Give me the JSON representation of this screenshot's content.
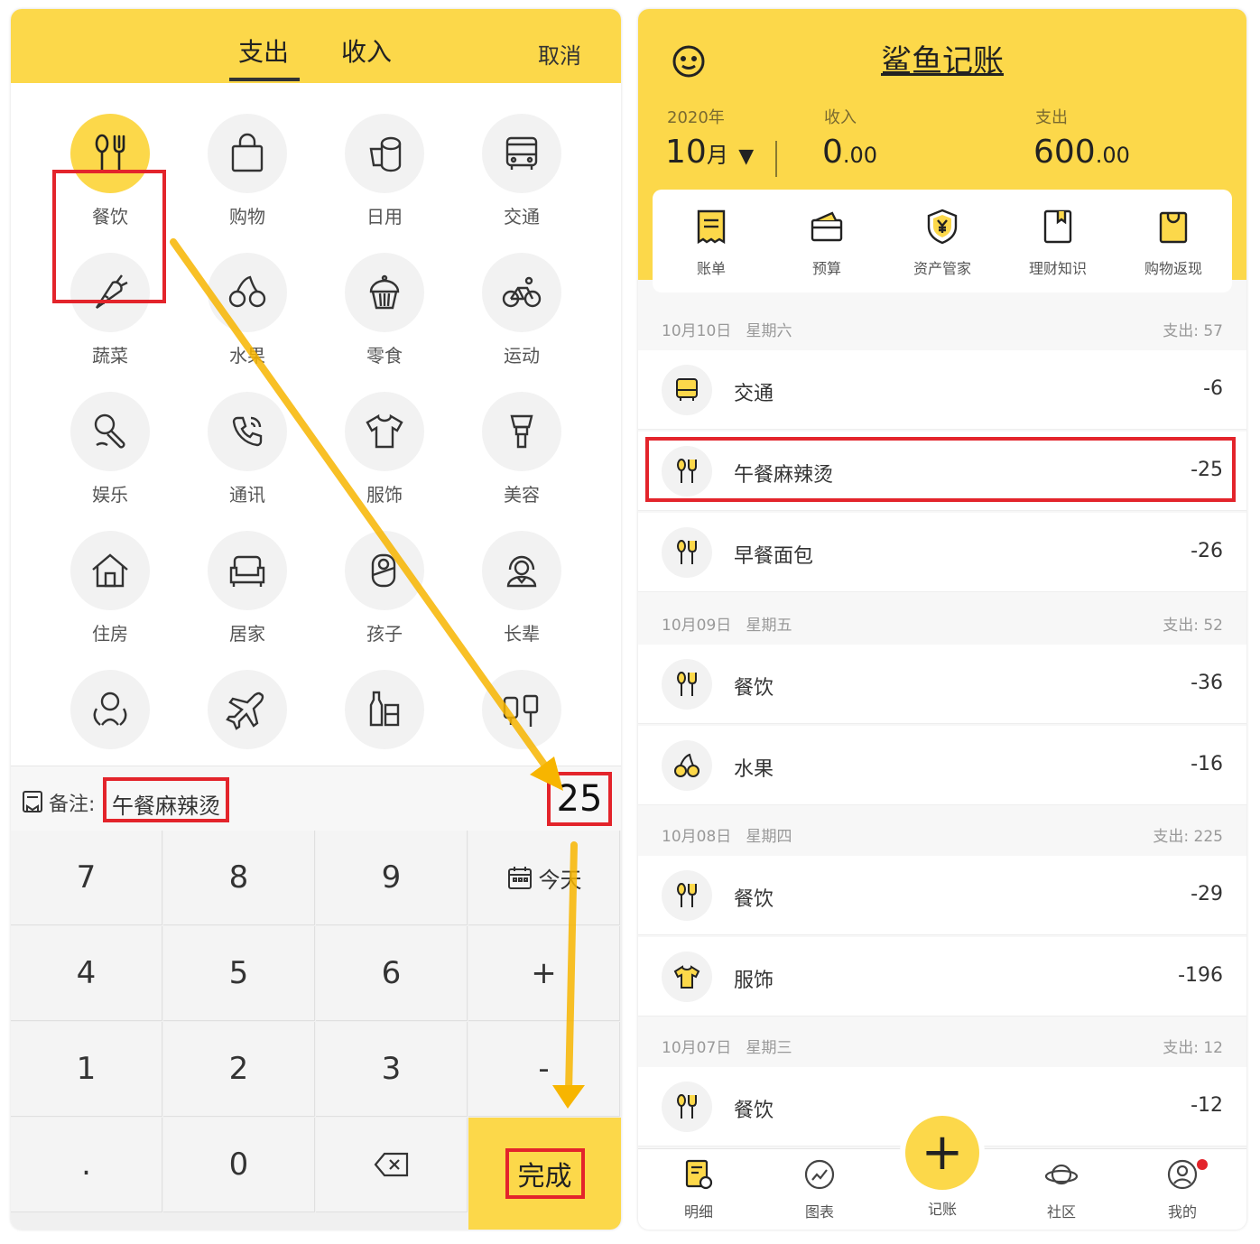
{
  "left": {
    "tabs": {
      "expense": "支出",
      "income": "收入"
    },
    "cancel": "取消",
    "categories": [
      {
        "label": "餐饮",
        "icon": "fork-spoon-icon"
      },
      {
        "label": "购物",
        "icon": "shopping-bag-icon"
      },
      {
        "label": "日用",
        "icon": "tissue-roll-icon"
      },
      {
        "label": "交通",
        "icon": "bus-icon"
      },
      {
        "label": "蔬菜",
        "icon": "carrot-icon"
      },
      {
        "label": "水果",
        "icon": "cherry-icon"
      },
      {
        "label": "零食",
        "icon": "cupcake-icon"
      },
      {
        "label": "运动",
        "icon": "bicycle-icon"
      },
      {
        "label": "娱乐",
        "icon": "microphone-icon"
      },
      {
        "label": "通讯",
        "icon": "phone-icon"
      },
      {
        "label": "服饰",
        "icon": "tshirt-icon"
      },
      {
        "label": "美容",
        "icon": "makeup-brush-icon"
      },
      {
        "label": "住房",
        "icon": "house-icon"
      },
      {
        "label": "居家",
        "icon": "sofa-icon"
      },
      {
        "label": "孩子",
        "icon": "baby-icon"
      },
      {
        "label": "长辈",
        "icon": "elder-icon"
      },
      {
        "label": "",
        "icon": "social-icon"
      },
      {
        "label": "",
        "icon": "airplane-icon"
      },
      {
        "label": "",
        "icon": "bottles-icon"
      },
      {
        "label": "",
        "icon": "digital-icon"
      }
    ],
    "note_label": "备注:",
    "note_value": "午餐麻辣烫",
    "amount": "25",
    "keypad": {
      "k7": "7",
      "k8": "8",
      "k9": "9",
      "today": "今天",
      "k4": "4",
      "k5": "5",
      "k6": "6",
      "plus": "+",
      "k1": "1",
      "k2": "2",
      "k3": "3",
      "minus": "-",
      "dot": ".",
      "k0": "0",
      "done": "完成"
    }
  },
  "right": {
    "title": "鲨鱼记账",
    "year": "2020年",
    "month": "10",
    "month_unit": "月",
    "caret": "▼",
    "income_label": "收入",
    "income_int": "0",
    "income_dec": ".00",
    "expense_label": "支出",
    "expense_int": "600",
    "expense_dec": ".00",
    "quick": [
      "账单",
      "预算",
      "资产管家",
      "理财知识",
      "购物返现"
    ],
    "groups": [
      {
        "date": "10月10日",
        "weekday": "星期六",
        "total_label": "支出:",
        "total": "57"
      },
      {
        "date": "10月09日",
        "weekday": "星期五",
        "total_label": "支出:",
        "total": "52"
      },
      {
        "date": "10月08日",
        "weekday": "星期四",
        "total_label": "支出:",
        "total": "225"
      },
      {
        "date": "10月07日",
        "weekday": "星期三",
        "total_label": "支出:",
        "total": "12"
      }
    ],
    "items": [
      {
        "name": "交通",
        "amount": "-6"
      },
      {
        "name": "午餐麻辣烫",
        "amount": "-25"
      },
      {
        "name": "早餐面包",
        "amount": "-26"
      },
      {
        "name": "餐饮",
        "amount": "-36"
      },
      {
        "name": "水果",
        "amount": "-16"
      },
      {
        "name": "餐饮",
        "amount": "-29"
      },
      {
        "name": "服饰",
        "amount": "-196"
      },
      {
        "name": "餐饮",
        "amount": "-12"
      }
    ],
    "tabbar": {
      "detail": "明细",
      "chart": "图表",
      "record": "记账",
      "community": "社区",
      "mine": "我的"
    },
    "fab": "+"
  },
  "colors": {
    "accent": "#fcd84a",
    "highlight": "#e3242b",
    "arrow": "#f7b500"
  }
}
